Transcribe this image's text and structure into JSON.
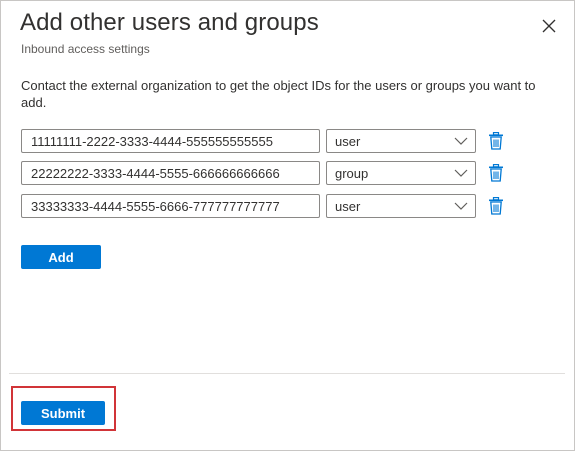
{
  "dialog": {
    "title": "Add other users and groups",
    "subtitle": "Inbound access settings",
    "close_icon": "close-icon"
  },
  "description": "Contact the external organization to get the object IDs for the users or groups you want to add.",
  "entries": [
    {
      "object_id": "11111111-2222-3333-4444-555555555555",
      "type": "user"
    },
    {
      "object_id": "22222222-3333-4444-5555-666666666666",
      "type": "group"
    },
    {
      "object_id": "33333333-4444-5555-6666-777777777777",
      "type": "user"
    }
  ],
  "type_options": [
    "user",
    "group"
  ],
  "buttons": {
    "add_label": "Add",
    "submit_label": "Submit"
  },
  "icons": {
    "delete": "trash-icon",
    "dropdown": "chevron-down-icon"
  },
  "colors": {
    "primary": "#0078d4",
    "delete_icon": "#0078d4",
    "highlight": "#d13438"
  }
}
